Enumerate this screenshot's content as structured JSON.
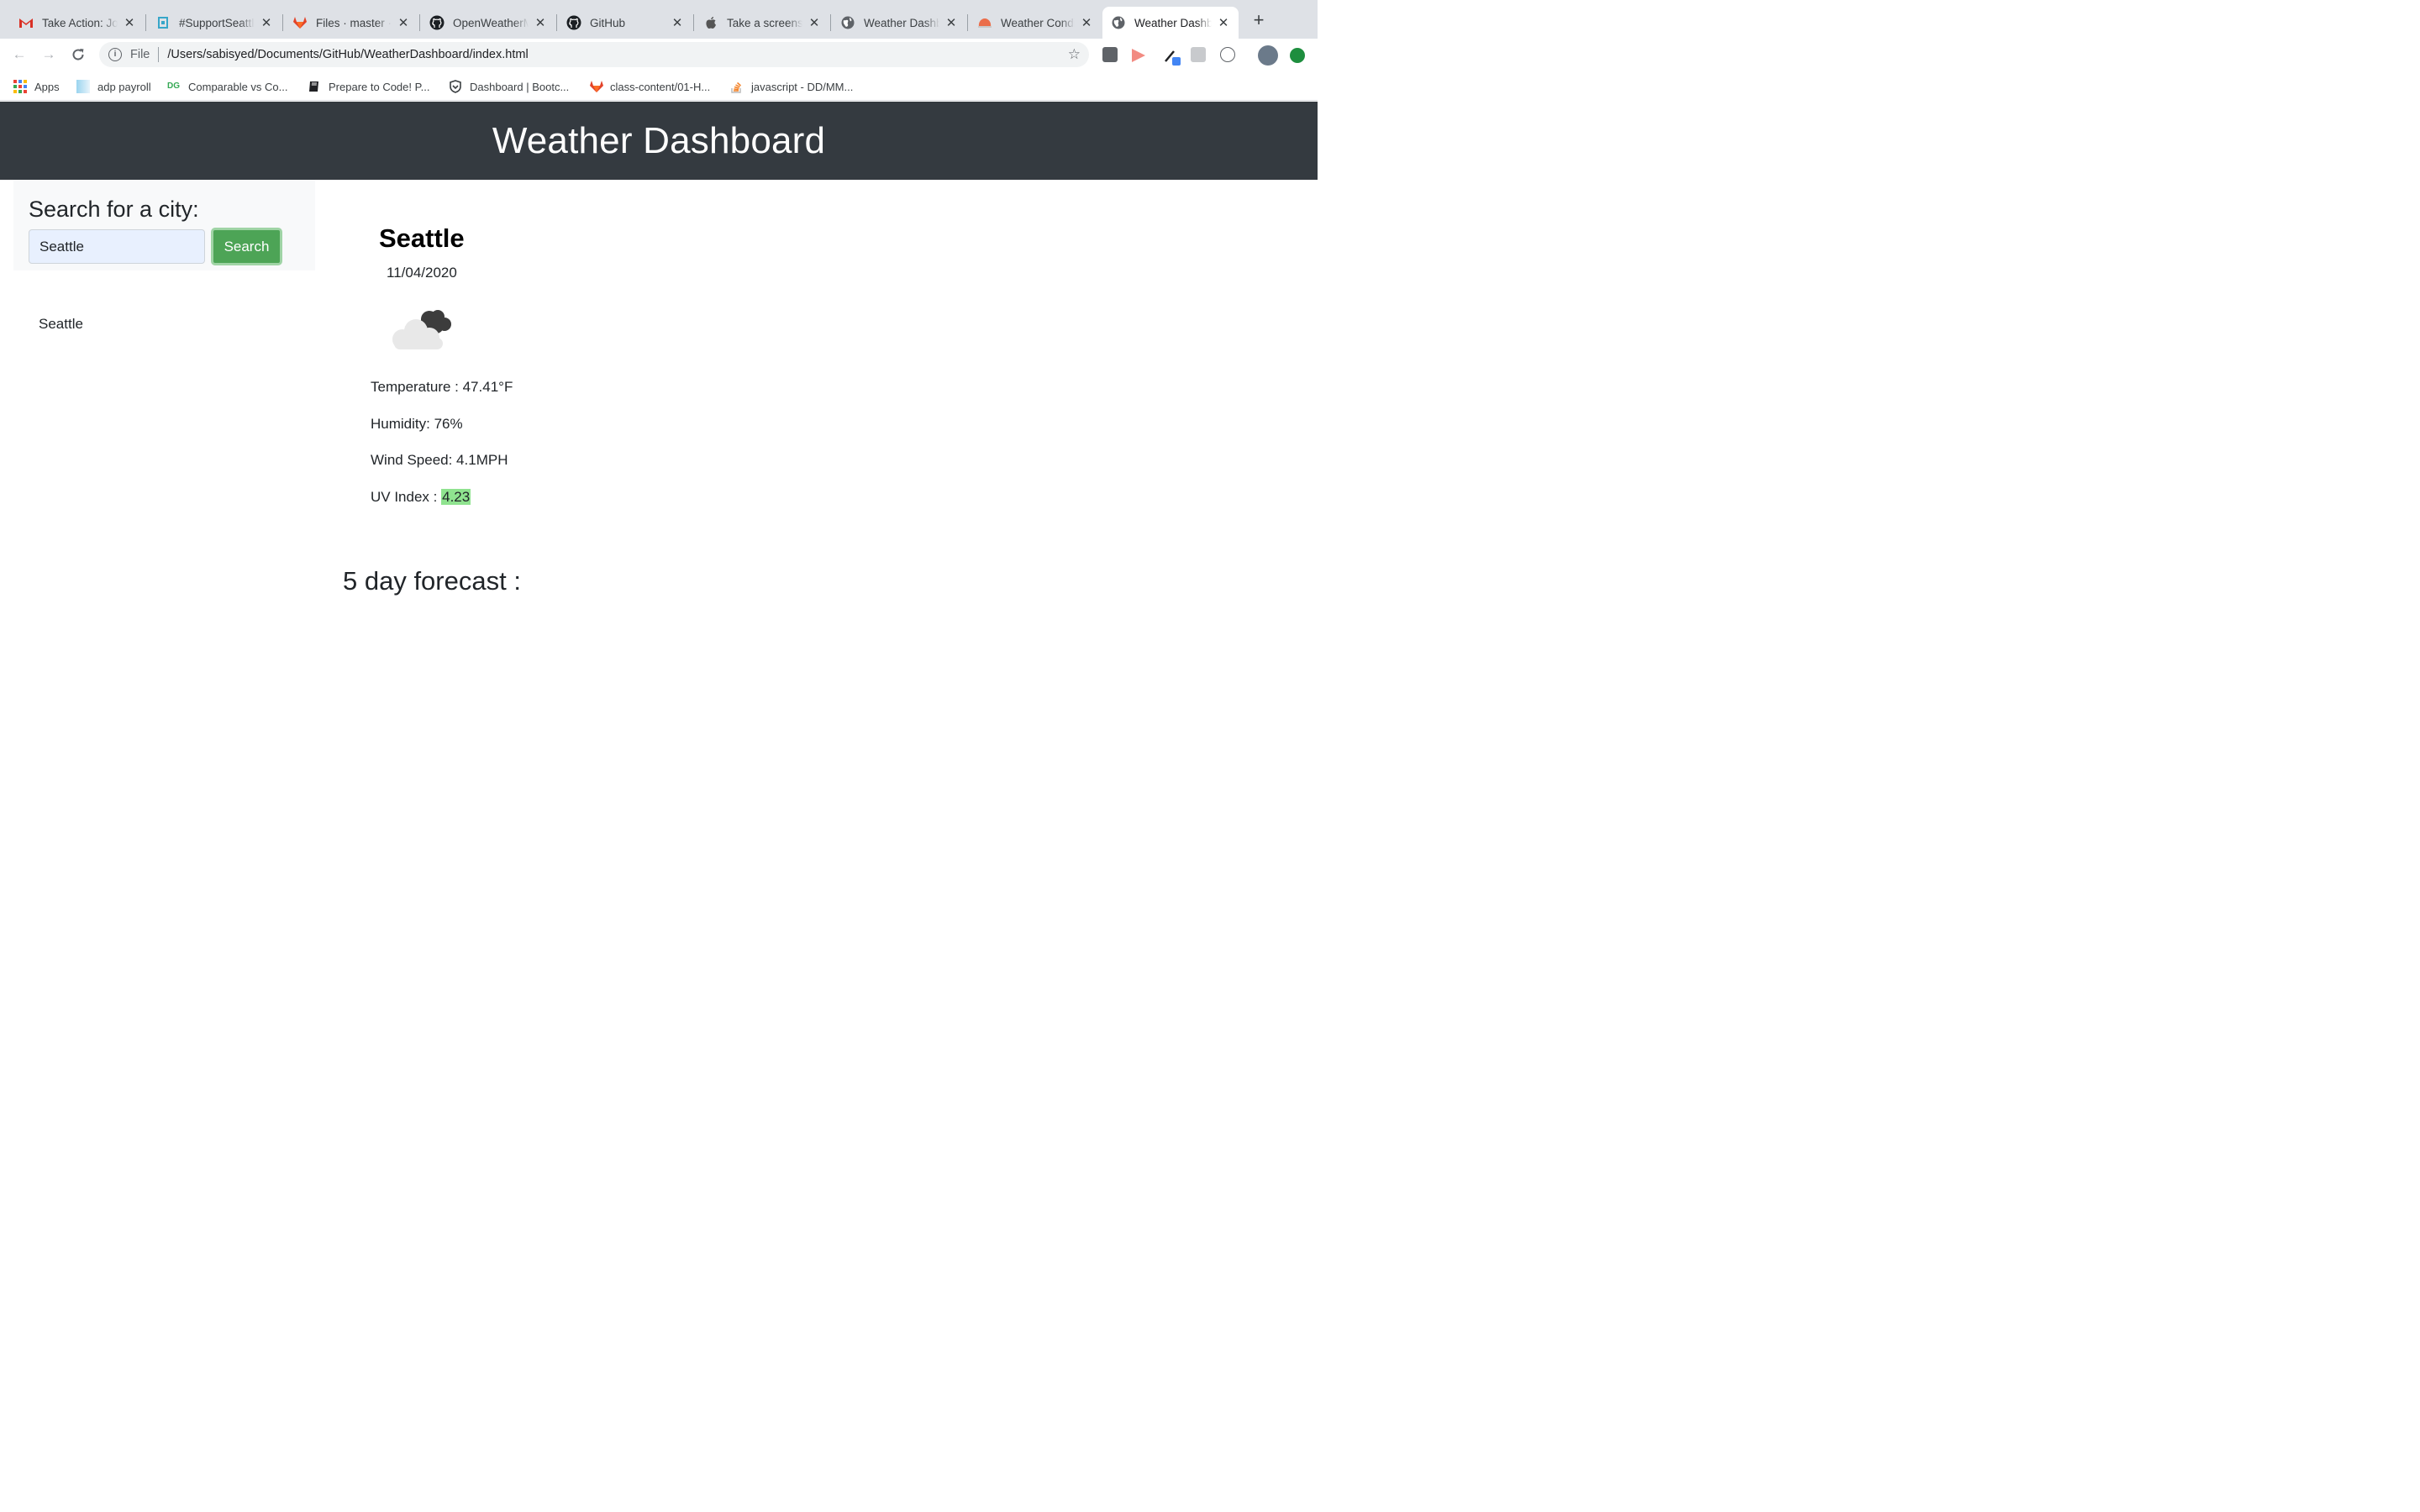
{
  "browser": {
    "tabs": [
      {
        "title": "Take Action: Job",
        "icon": "gmail-icon"
      },
      {
        "title": "#SupportSeattle",
        "icon": "support-icon"
      },
      {
        "title": "Files · master · U",
        "icon": "gitlab-icon"
      },
      {
        "title": "OpenWeatherMap",
        "icon": "github-icon"
      },
      {
        "title": "GitHub",
        "icon": "github-icon"
      },
      {
        "title": "Take a screenshot",
        "icon": "apple-icon"
      },
      {
        "title": "Weather Dashboard",
        "icon": "globe-icon"
      },
      {
        "title": "Weather Conditions",
        "icon": "weather-icon"
      },
      {
        "title": "Weather Dashboard",
        "icon": "globe-icon",
        "active": true
      }
    ],
    "address": {
      "scheme": "File",
      "url": "/Users/sabisyed/Documents/GitHub/WeatherDashboard/index.html"
    },
    "bookmarks": [
      {
        "label": "Apps",
        "icon": "apps-grid-icon"
      },
      {
        "label": "adp payroll",
        "icon": "adp-icon"
      },
      {
        "label": "Comparable vs Co...",
        "icon": "dg-icon"
      },
      {
        "label": "Prepare to Code! P...",
        "icon": "book-icon"
      },
      {
        "label": "Dashboard | Bootc...",
        "icon": "shield-icon"
      },
      {
        "label": "class-content/01-H...",
        "icon": "gitlab-icon"
      },
      {
        "label": "javascript - DD/MM...",
        "icon": "stackoverflow-icon"
      }
    ]
  },
  "header": {
    "title": "Weather Dashboard"
  },
  "search": {
    "heading": "Search for a city:",
    "input_value": "Seattle",
    "button_label": "Search"
  },
  "history": [
    "Seattle"
  ],
  "current": {
    "city": "Seattle",
    "date": "11/04/2020",
    "icon": "cloudy-icon",
    "temperature": "Temperature : 47.41°F",
    "humidity": "Humidity: 76%",
    "wind": "Wind Speed: 4.1MPH",
    "uv_label": "UV Index : ",
    "uv_value": "4.23"
  },
  "forecast": {
    "title": "5 day forecast :"
  },
  "colors": {
    "header_bg": "#343a40",
    "search_button": "#4da456",
    "uv_badge": "#8fe38f"
  }
}
